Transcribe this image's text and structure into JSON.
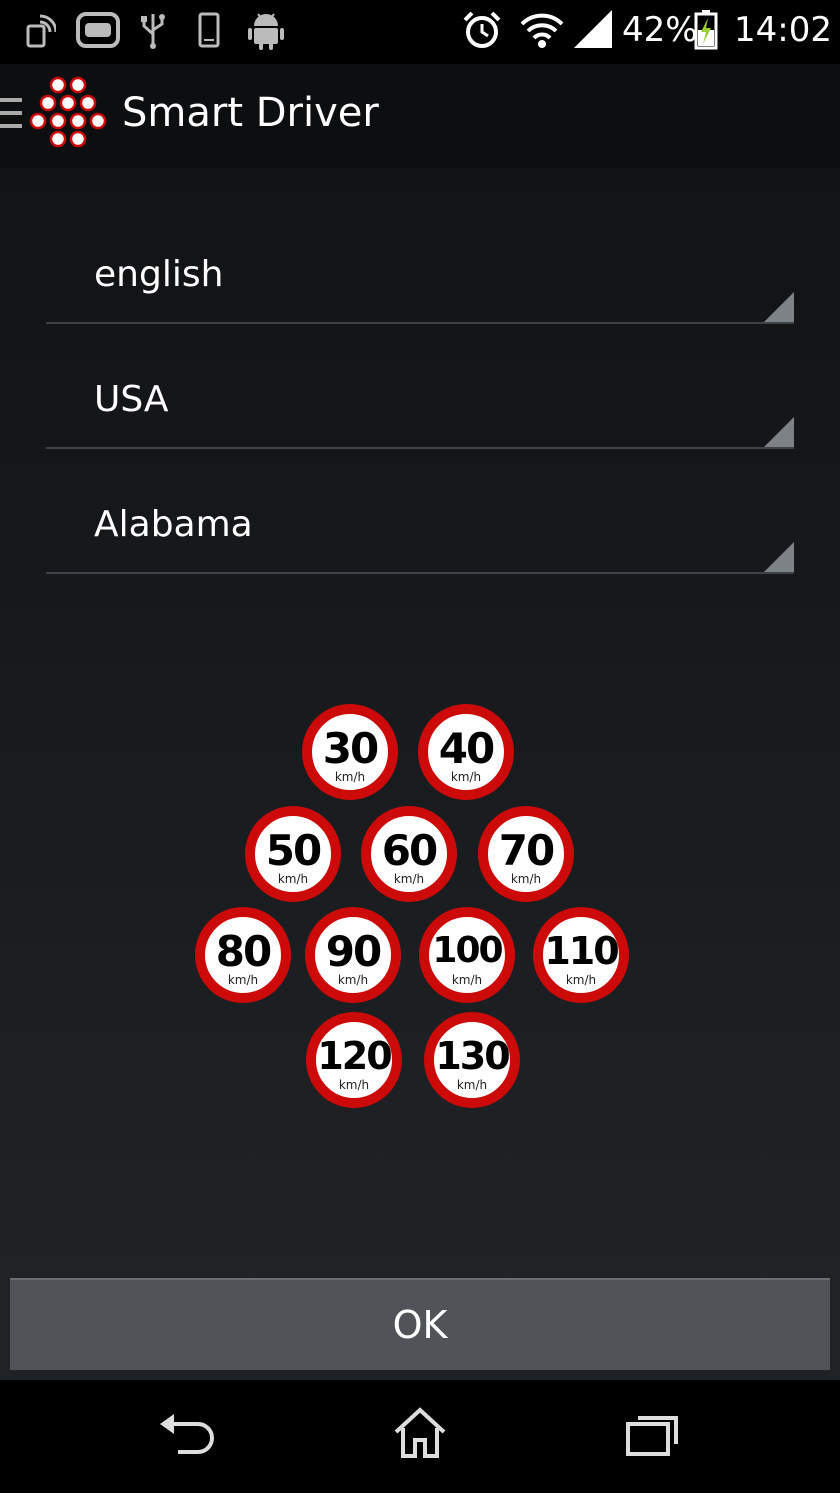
{
  "status_bar": {
    "battery_percent": "42%",
    "time": "14:02"
  },
  "action_bar": {
    "title": "Smart Driver"
  },
  "spinners": {
    "language": "english",
    "country": "USA",
    "region": "Alabama"
  },
  "speed_signs": {
    "unit": "km/h",
    "rows": [
      [
        "30",
        "40"
      ],
      [
        "50",
        "60",
        "70"
      ],
      [
        "80",
        "90",
        "100",
        "110"
      ],
      [
        "120",
        "130"
      ]
    ]
  },
  "ok_button": {
    "label": "OK"
  },
  "colors": {
    "sign_red": "#cc0a0a",
    "button_bg": "#505458"
  }
}
